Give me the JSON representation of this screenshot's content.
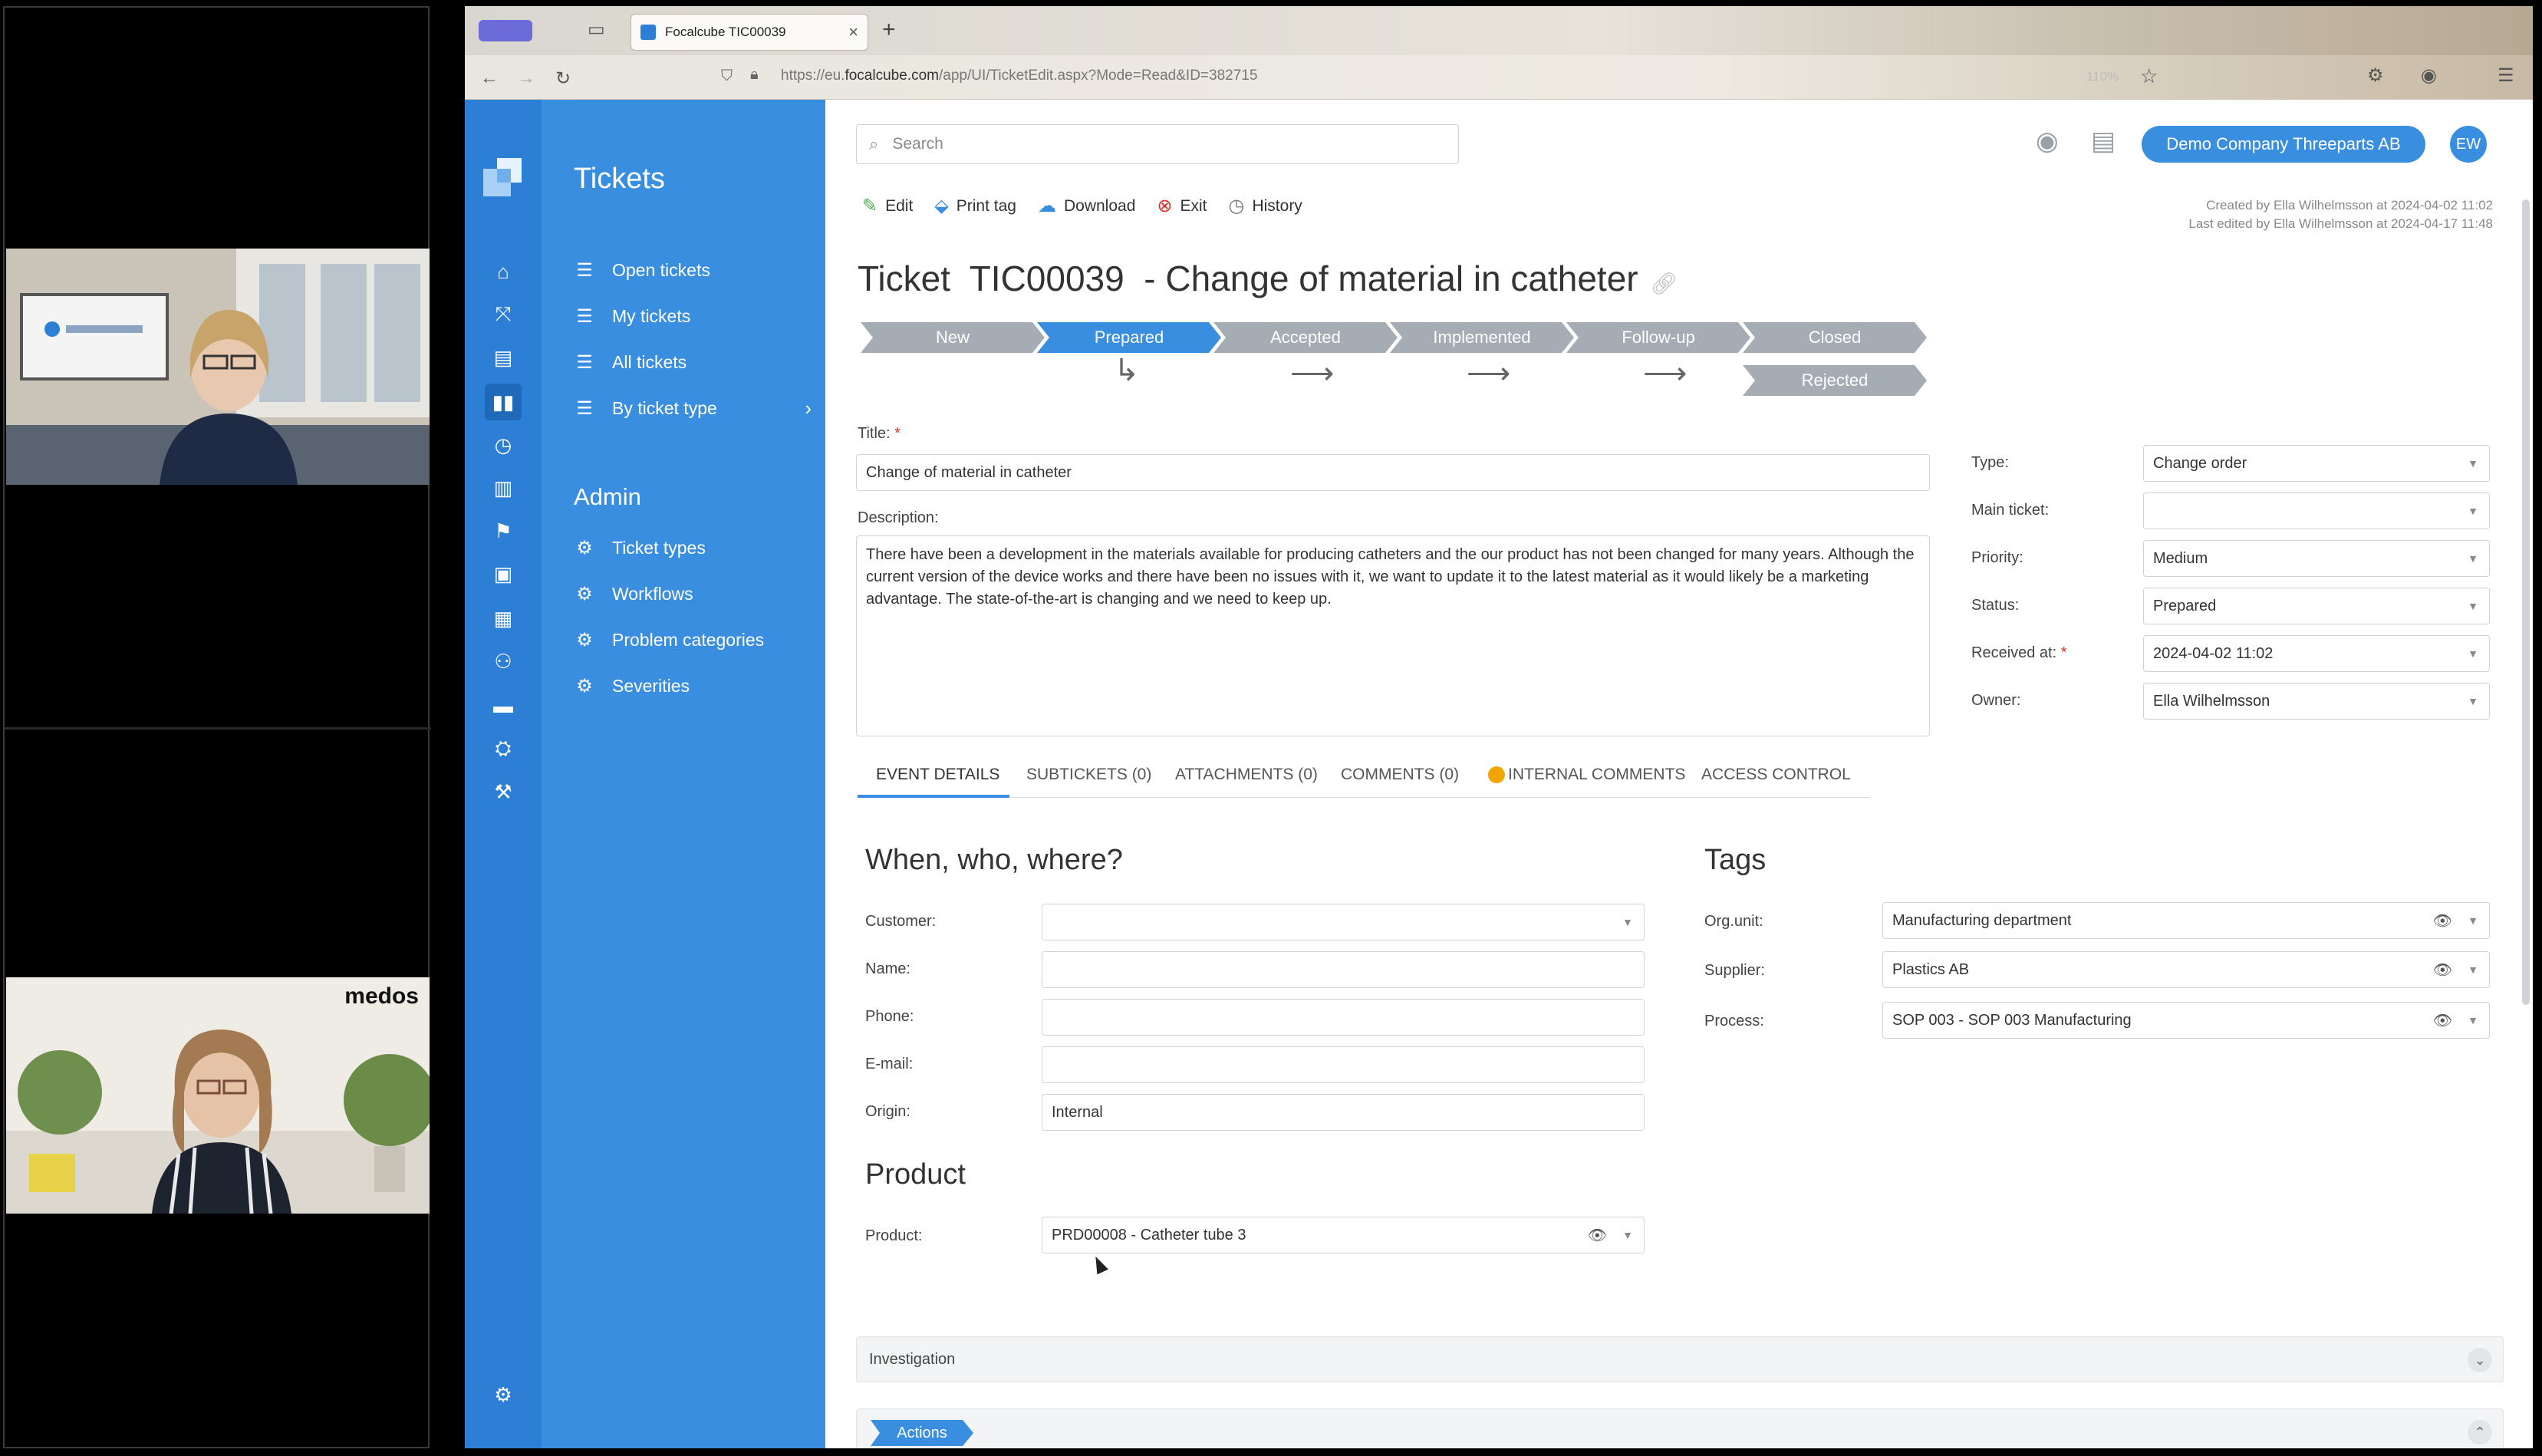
{
  "browser": {
    "tab_title": "Focalcube TIC00039",
    "url_prefix": "https://eu.",
    "url_domain": "focalcube.com",
    "url_path": "/app/UI/TicketEdit.aspx?Mode=Read&ID=382715",
    "zoom": "110%"
  },
  "sidebar": {
    "title": "Tickets",
    "items": [
      {
        "label": "Open tickets"
      },
      {
        "label": "My tickets"
      },
      {
        "label": "All tickets"
      },
      {
        "label": "By ticket type"
      }
    ],
    "admin_title": "Admin",
    "admin_items": [
      {
        "label": "Ticket types"
      },
      {
        "label": "Workflows"
      },
      {
        "label": "Problem categories"
      },
      {
        "label": "Severities"
      }
    ]
  },
  "header": {
    "search_placeholder": "Search",
    "company": "Demo Company Threeparts AB",
    "avatar": "EW"
  },
  "toolbar": {
    "edit": "Edit",
    "print_tag": "Print tag",
    "download": "Download",
    "exit": "Exit",
    "history": "History"
  },
  "meta": {
    "created": "Created by Ella Wilhelmsson at 2024-04-02 11:02",
    "edited": "Last edited by Ella Wilhelmsson at 2024-04-17 11:48"
  },
  "ticket": {
    "heading": "Ticket  TIC00039  - Change of material in catheter"
  },
  "workflow": {
    "steps": [
      "New",
      "Prepared",
      "Accepted",
      "Implemented",
      "Follow-up",
      "Closed"
    ],
    "rejected": "Rejected",
    "active_step": "Prepared"
  },
  "form": {
    "title_label": "Title:",
    "title_value": "Change of material in catheter",
    "description_label": "Description:",
    "description_value": "There have been a development in the materials available for producing catheters and the our product has not been changed for many years. Although the current version of the device works and there have been no issues with it, we want to update it to the latest material as it would likely be a marketing advantage. The state-of-the-art is changing and we need to keep up.",
    "type_label": "Type:",
    "type_value": "Change order",
    "main_ticket_label": "Main ticket:",
    "main_ticket_value": "",
    "priority_label": "Priority:",
    "priority_value": "Medium",
    "status_label": "Status:",
    "status_value": "Prepared",
    "received_label": "Received at:",
    "received_value": "2024-04-02 11:02",
    "owner_label": "Owner:",
    "owner_value": "Ella Wilhelmsson"
  },
  "tabs": [
    "EVENT DETAILS",
    "SUBTICKETS (0)",
    "ATTACHMENTS (0)",
    "COMMENTS (0)",
    "INTERNAL COMMENTS",
    "ACCESS CONTROL"
  ],
  "event": {
    "heading": "When, who, where?",
    "customer_label": "Customer:",
    "name_label": "Name:",
    "phone_label": "Phone:",
    "email_label": "E-mail:",
    "origin_label": "Origin:",
    "origin_value": "Internal"
  },
  "tags": {
    "heading": "Tags",
    "orgunit_label": "Org.unit:",
    "orgunit_value": "Manufacturing department",
    "supplier_label": "Supplier:",
    "supplier_value": "Plastics AB",
    "process_label": "Process:",
    "process_value": "SOP 003 - SOP 003 Manufacturing"
  },
  "product": {
    "heading": "Product",
    "product_label": "Product:",
    "product_value": "PRD00008 - Catheter tube 3"
  },
  "sections": {
    "investigation": "Investigation",
    "actions": "Actions"
  },
  "video": {
    "brand_label": "medos"
  },
  "colors": {
    "primary": "#3a8ee0",
    "rail": "#2d7fd6",
    "step_inactive": "#a6acb3"
  }
}
